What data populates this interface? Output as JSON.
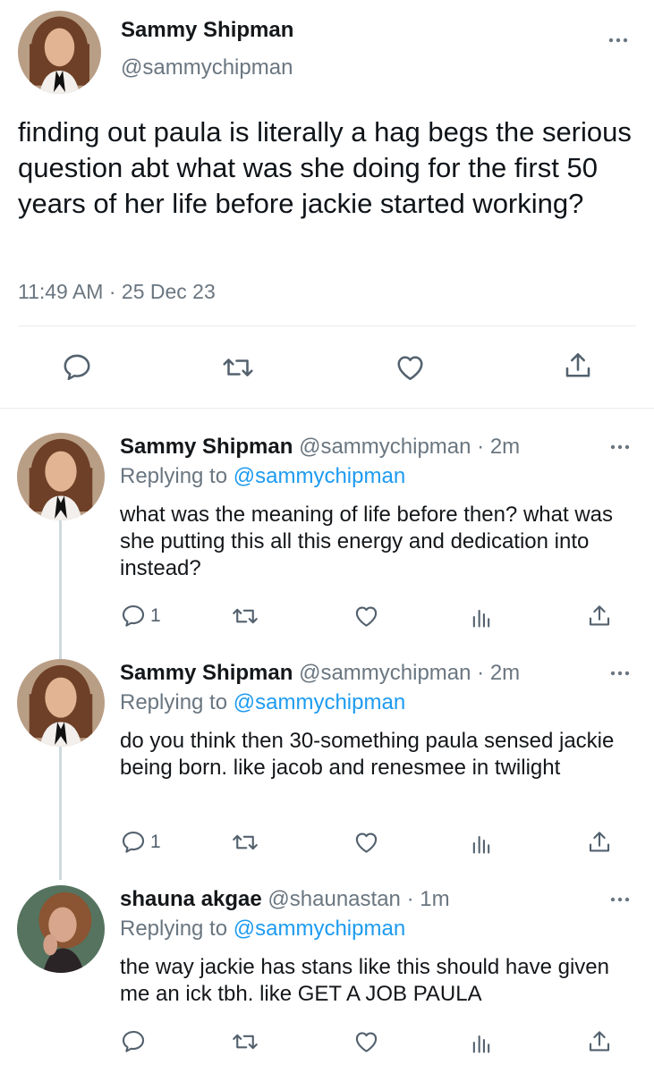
{
  "main_tweet": {
    "author_name": "Sammy Shipman",
    "author_handle": "@sammychipman",
    "text": "finding out paula is literally a hag begs the serious question abt what was she doing for the first 50 years of her life before jackie started working?",
    "timestamp": "11:49 AM · 25 Dec 23",
    "actions": [
      "reply-icon",
      "retweet-icon",
      "like-icon",
      "share-icon"
    ]
  },
  "replies": [
    {
      "author_name": "Sammy Shipman",
      "author_handle": "@sammychipman",
      "age": "· 2m",
      "replying_prefix": "Replying to",
      "replying_to": "@sammychipman",
      "text": "what was the meaning of life before then? what was she putting this all this energy and dedication into instead?",
      "reply_count": "1"
    },
    {
      "author_name": "Sammy Shipman",
      "author_handle": "@sammychipman",
      "age": "· 2m",
      "replying_prefix": "Replying to",
      "replying_to": "@sammychipman",
      "text": "do you think then 30-something paula sensed jackie being born. like jacob and renesmee in twilight",
      "reply_count": "1"
    },
    {
      "author_name": "shauna akgae",
      "author_handle": "@shaunastan",
      "age": "· 1m",
      "replying_prefix": "Replying to",
      "replying_to": "@sammychipman",
      "text": "the way jackie has stans like this should have given me an ick tbh. like GET A JOB PAULA",
      "reply_count": ""
    }
  ],
  "colors": {
    "link": "#1d9bf0",
    "muted": "#6a7680",
    "divider": "#e6ecf0",
    "thread_line": "#cfd9de"
  }
}
